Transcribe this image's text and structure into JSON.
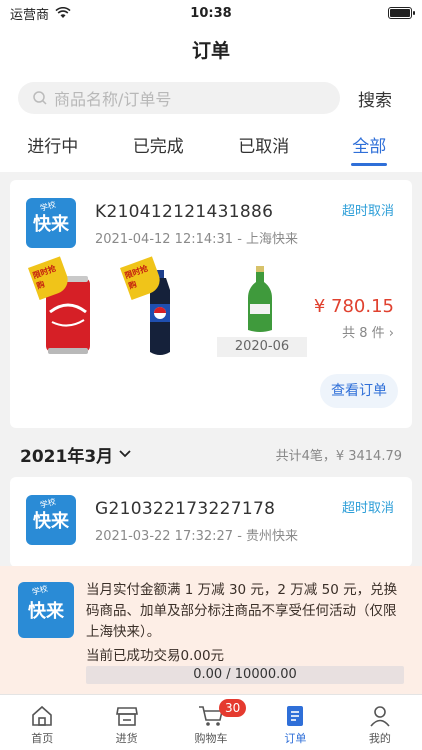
{
  "status_bar": {
    "carrier": "运营商",
    "time": "10:38"
  },
  "nav": {
    "title": "订单"
  },
  "search": {
    "placeholder": "商品名称/订单号",
    "button": "搜索"
  },
  "tabs": [
    {
      "label": "进行中",
      "active": false
    },
    {
      "label": "已完成",
      "active": false
    },
    {
      "label": "已取消",
      "active": false
    },
    {
      "label": "全部",
      "active": true
    }
  ],
  "orders": [
    {
      "id": "K210412121431886",
      "meta": "2021-04-12 12:14:31 - 上海快来",
      "status": "超时取消",
      "logo_text": "快来",
      "logo_tag": "学校",
      "products": [
        {
          "name": "coca-cola-can",
          "tag": "限时抢购"
        },
        {
          "name": "pepsi-bottle",
          "tag": "限时抢购"
        },
        {
          "name": "green-bottle",
          "date": "2020-06"
        }
      ],
      "price": "¥ 780.15",
      "count": "共 8 件",
      "view_button": "查看订单"
    },
    {
      "id": "G210322173227178",
      "meta": "2021-03-22 17:32:27 - 贵州快来",
      "status": "超时取消",
      "logo_text": "快来",
      "logo_tag": "学校"
    }
  ],
  "month_group": {
    "label": "2021年3月",
    "summary": "共计4笔，¥ 3414.79"
  },
  "promo": {
    "logo_text": "快来",
    "logo_tag": "学校",
    "text": "当月实付金额满 1 万减 30 元，2 万减 50 元，兑换码商品、加单及部分标注商品不享受任何活动（仅限上海快来）。",
    "progress_text": "当前已成功交易0.00元",
    "progress_label": "0.00 / 10000.00",
    "progress_fraction": 0.0
  },
  "tabbar": [
    {
      "label": "首页",
      "icon": "home-icon",
      "active": false
    },
    {
      "label": "进货",
      "icon": "store-icon",
      "active": false
    },
    {
      "label": "购物车",
      "icon": "cart-icon",
      "active": false,
      "badge": "30"
    },
    {
      "label": "订单",
      "icon": "order-icon",
      "active": true
    },
    {
      "label": "我的",
      "icon": "profile-icon",
      "active": false
    }
  ],
  "colors": {
    "accent": "#2f6fd8",
    "price": "#e0412f",
    "status": "#2f9fd8",
    "logo": "#2a8bd6"
  }
}
